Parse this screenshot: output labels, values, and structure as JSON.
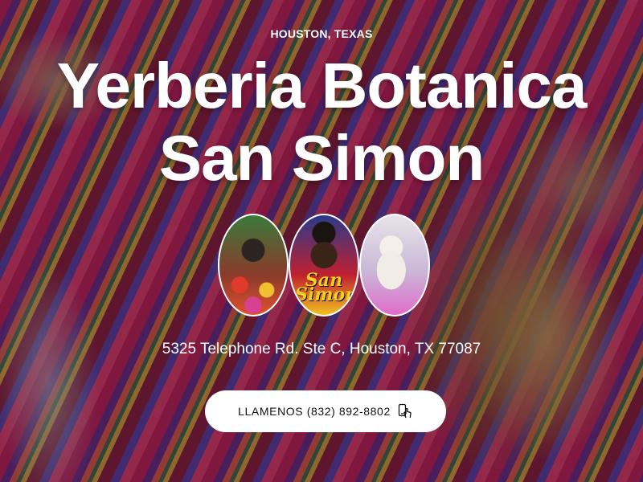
{
  "hero": {
    "eyebrow": "HOUSTON, TEXAS",
    "title": "Yerberia Botanica San Simon",
    "photos": [
      {
        "name": "altar-photo",
        "caption": ""
      },
      {
        "name": "san-simon-photo",
        "caption": "San Simon"
      },
      {
        "name": "cat-photo",
        "caption": ""
      }
    ],
    "address": "5325 Telephone Rd. Ste C, Houston, TX 77087",
    "cta": {
      "label": "LLAMENOS (832) 892-8802",
      "icon": "phone-tap-icon"
    }
  },
  "colors": {
    "button_bg": "#ffffff",
    "text": "#ffffff",
    "button_text": "#111111"
  }
}
